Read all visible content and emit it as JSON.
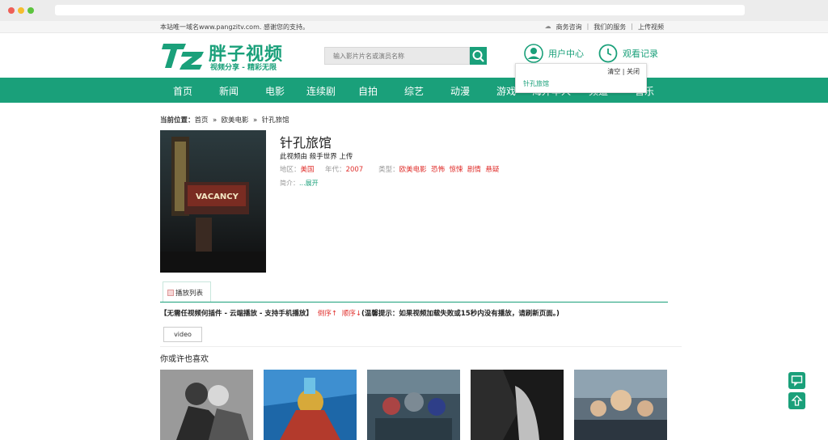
{
  "top": {
    "notice": "本站唯一域名www.pangzitv.com. 感谢您的支持。",
    "links": [
      "商务咨询",
      "我们的服务",
      "上传视频"
    ]
  },
  "header": {
    "brand": "胖子视频",
    "slogan": "视频分享 - 精彩无限",
    "search_placeholder": "输入影片片名或演员名称",
    "user_center": "用户中心",
    "history": "观看记录"
  },
  "nav": [
    "首页",
    "新闻",
    "电影",
    "连续剧",
    "自拍",
    "综艺",
    "动漫",
    "游戏",
    "海外华人",
    "频道",
    "音乐"
  ],
  "history_popup": {
    "clear": "清空",
    "close": "关闭",
    "item": "针孔旅馆"
  },
  "breadcrumb": {
    "label": "当前位置：",
    "items": [
      "首页",
      "欧美电影",
      "针孔旅馆"
    ],
    "separator": "»"
  },
  "movie": {
    "title": "针孔旅馆",
    "uploader": "此视频由 殺手世界 上传",
    "region_label": "地区：",
    "region": "美国",
    "year_label": "年代：",
    "year": "2007",
    "genre_label": "类型：",
    "genres": [
      "欧美电影",
      "恐怖",
      "惊悚",
      "剧情",
      "悬疑"
    ],
    "intro_label": "简介：",
    "expand": "...展开",
    "poster_text": "VACANCY"
  },
  "playlist": {
    "tab": "播放列表",
    "info": "【无需任视频何插件 - 云端播放 - 支持手机播放】",
    "desc_order": "倒序↑",
    "asc_order": "顺序↓",
    "tip": "(温馨提示：如果视频加载失败或15秒内没有播放，请刷新页面。)",
    "source": "video"
  },
  "recommend": {
    "title": "你或许也喜欢"
  },
  "colors": {
    "brand": "#1aa07a",
    "accent_red": "#e0302d"
  }
}
